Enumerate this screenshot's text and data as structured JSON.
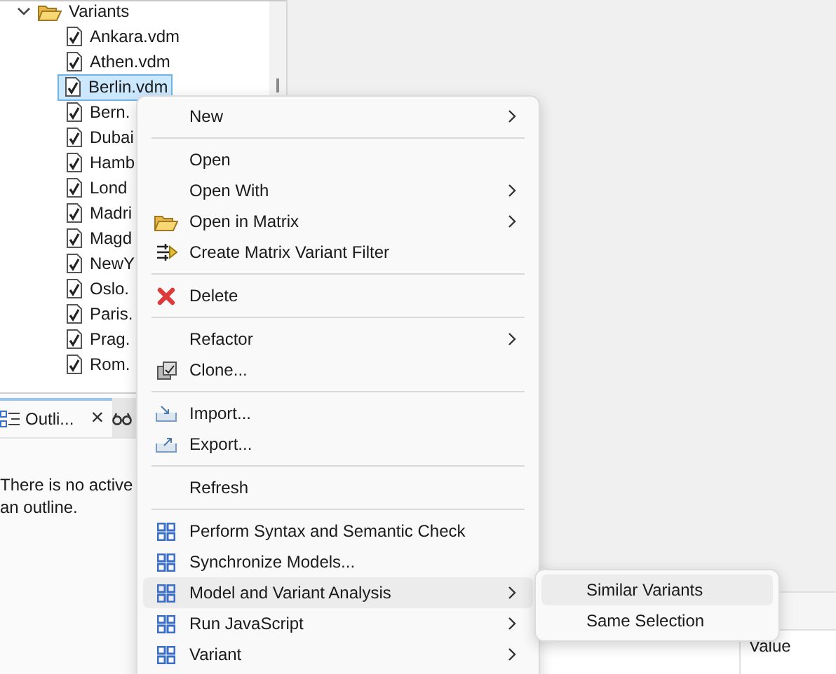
{
  "tree": {
    "folder": {
      "label": "Variants",
      "expanded": true,
      "children": [
        {
          "label": "Ankara.vdm",
          "selected": false
        },
        {
          "label": "Athen.vdm",
          "selected": false
        },
        {
          "label": "Berlin.vdm",
          "selected": true
        },
        {
          "label": "Bern.",
          "selected": false
        },
        {
          "label": "Dubai",
          "selected": false
        },
        {
          "label": "Hamb",
          "selected": false
        },
        {
          "label": "Lond",
          "selected": false
        },
        {
          "label": "Madri",
          "selected": false
        },
        {
          "label": "Magd",
          "selected": false
        },
        {
          "label": "NewY",
          "selected": false
        },
        {
          "label": "Oslo.",
          "selected": false
        },
        {
          "label": "Paris.",
          "selected": false
        },
        {
          "label": "Prag.",
          "selected": false
        },
        {
          "label": "Rom.",
          "selected": false
        }
      ]
    }
  },
  "outline": {
    "tabs": [
      {
        "kind": "outline",
        "label": "Outli...",
        "selected": true,
        "close": "×"
      },
      {
        "kind": "glasses",
        "selected": false
      }
    ],
    "message_lines": [
      "There is no active",
      "an outline."
    ]
  },
  "properties": {
    "columns": [
      "Value"
    ]
  },
  "context_menu": {
    "items": [
      {
        "kind": "plain",
        "label": "New",
        "submenu": true,
        "highlighted": false
      },
      {
        "kind": "separator"
      },
      {
        "kind": "plain",
        "label": "Open",
        "submenu": false,
        "highlighted": false
      },
      {
        "kind": "plain",
        "label": "Open With",
        "submenu": true,
        "highlighted": false
      },
      {
        "kind": "folder",
        "label": "Open in Matrix",
        "submenu": true,
        "highlighted": false
      },
      {
        "kind": "filter",
        "label": "Create Matrix Variant Filter",
        "submenu": false,
        "highlighted": false
      },
      {
        "kind": "separator"
      },
      {
        "kind": "delete",
        "label": "Delete",
        "submenu": false,
        "highlighted": false
      },
      {
        "kind": "separator"
      },
      {
        "kind": "plain",
        "label": "Refactor",
        "submenu": true,
        "highlighted": false
      },
      {
        "kind": "clone",
        "label": "Clone...",
        "submenu": false,
        "highlighted": false
      },
      {
        "kind": "separator"
      },
      {
        "kind": "import",
        "label": "Import...",
        "submenu": false,
        "highlighted": false
      },
      {
        "kind": "export",
        "label": "Export...",
        "submenu": false,
        "highlighted": false
      },
      {
        "kind": "separator"
      },
      {
        "kind": "plain",
        "label": "Refresh",
        "submenu": false,
        "highlighted": false
      },
      {
        "kind": "separator"
      },
      {
        "kind": "grid",
        "label": "Perform Syntax and Semantic Check",
        "submenu": false,
        "highlighted": false
      },
      {
        "kind": "grid",
        "label": "Synchronize Models...",
        "submenu": false,
        "highlighted": false
      },
      {
        "kind": "grid",
        "label": "Model and Variant Analysis",
        "submenu": true,
        "highlighted": true
      },
      {
        "kind": "grid",
        "label": "Run JavaScript",
        "submenu": true,
        "highlighted": false
      },
      {
        "kind": "grid",
        "label": "Variant",
        "submenu": true,
        "highlighted": false
      }
    ]
  },
  "submenu": {
    "items": [
      {
        "label": "Similar Variants",
        "highlighted": true
      },
      {
        "label": "Same Selection",
        "highlighted": false
      }
    ]
  }
}
